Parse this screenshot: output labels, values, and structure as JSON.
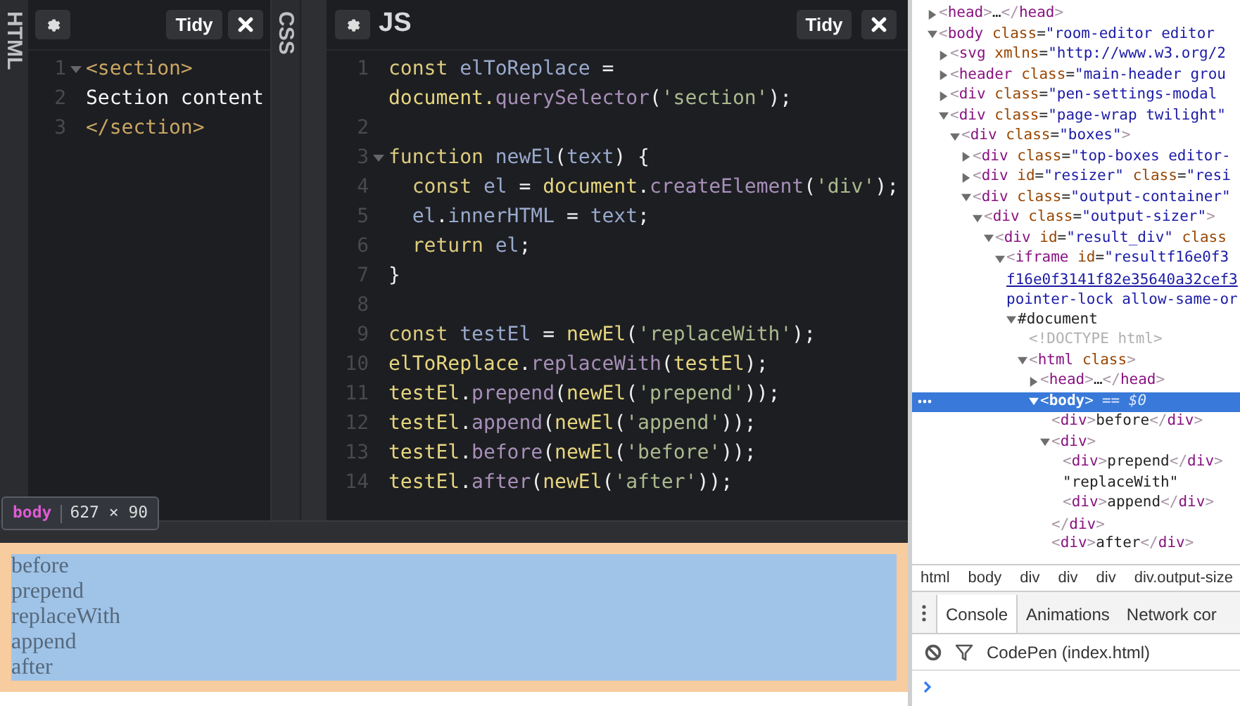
{
  "editors": {
    "html_panel": {
      "label": "HTML",
      "button": "Tidy",
      "lines": [
        {
          "number": "1",
          "foldable": true,
          "tokens": [
            {
              "text": "<section>",
              "kind": "tag"
            }
          ]
        },
        {
          "number": "2",
          "foldable": false,
          "tokens": [
            {
              "text": "Section content",
              "kind": "text"
            }
          ]
        },
        {
          "number": "3",
          "foldable": false,
          "tokens": [
            {
              "text": "</section>",
              "kind": "tag"
            }
          ]
        }
      ]
    },
    "css_panel": {
      "label": "CSS"
    },
    "js_panel": {
      "title": "JS",
      "button": "Tidy",
      "lines": [
        {
          "number": "1",
          "foldable": false,
          "tokens": [
            {
              "text": "const",
              "kind": "keyword"
            },
            {
              "text": " elToReplace",
              "kind": "variable"
            },
            {
              "text": " =",
              "kind": "punct"
            }
          ],
          "wrapped_tokens": [
            {
              "text": "document.",
              "kind": "name"
            },
            {
              "text": "querySelector",
              "kind": "method"
            },
            {
              "text": "(",
              "kind": "punct"
            },
            {
              "text": "'section'",
              "kind": "string"
            },
            {
              "text": ");",
              "kind": "punct"
            }
          ]
        },
        {
          "number": "2",
          "foldable": false
        },
        {
          "number": "3",
          "foldable": true,
          "tokens": [
            {
              "text": "function",
              "kind": "keyword"
            },
            {
              "text": " newEl",
              "kind": "variable"
            },
            {
              "text": "(",
              "kind": "punct"
            },
            {
              "text": "text",
              "kind": "variable"
            },
            {
              "text": ") {",
              "kind": "punct"
            }
          ]
        },
        {
          "number": "4",
          "foldable": false,
          "tokens": [
            {
              "text": "  const",
              "kind": "keyword"
            },
            {
              "text": " el",
              "kind": "variable"
            },
            {
              "text": " = ",
              "kind": "punct"
            },
            {
              "text": "document",
              "kind": "name"
            },
            {
              "text": ".",
              "kind": "punct"
            },
            {
              "text": "createElement",
              "kind": "method"
            },
            {
              "text": "(",
              "kind": "punct"
            },
            {
              "text": "'div'",
              "kind": "string"
            },
            {
              "text": ");",
              "kind": "punct"
            }
          ]
        },
        {
          "number": "5",
          "foldable": false,
          "tokens": [
            {
              "text": "  el",
              "kind": "variable"
            },
            {
              "text": ".",
              "kind": "punct"
            },
            {
              "text": "innerHTML",
              "kind": "variable"
            },
            {
              "text": " = ",
              "kind": "punct"
            },
            {
              "text": "text",
              "kind": "variable"
            },
            {
              "text": ";",
              "kind": "punct"
            }
          ]
        },
        {
          "number": "6",
          "foldable": false,
          "tokens": [
            {
              "text": "  return",
              "kind": "keyword"
            },
            {
              "text": " el",
              "kind": "variable"
            },
            {
              "text": ";",
              "kind": "punct"
            }
          ]
        },
        {
          "number": "7",
          "foldable": false,
          "tokens": [
            {
              "text": "}",
              "kind": "punct"
            }
          ]
        },
        {
          "number": "8",
          "foldable": false
        },
        {
          "number": "9",
          "foldable": false,
          "tokens": [
            {
              "text": "const",
              "kind": "keyword"
            },
            {
              "text": " testEl",
              "kind": "variable"
            },
            {
              "text": " = ",
              "kind": "punct"
            },
            {
              "text": "newEl",
              "kind": "name"
            },
            {
              "text": "(",
              "kind": "punct"
            },
            {
              "text": "'replaceWith'",
              "kind": "string"
            },
            {
              "text": ");",
              "kind": "punct"
            }
          ]
        },
        {
          "number": "10",
          "foldable": false,
          "tokens": [
            {
              "text": "elToReplace",
              "kind": "name"
            },
            {
              "text": ".",
              "kind": "punct"
            },
            {
              "text": "replaceWith",
              "kind": "method"
            },
            {
              "text": "(",
              "kind": "punct"
            },
            {
              "text": "testEl",
              "kind": "name"
            },
            {
              "text": ");",
              "kind": "punct"
            }
          ]
        },
        {
          "number": "11",
          "foldable": false,
          "tokens": [
            {
              "text": "testEl",
              "kind": "name"
            },
            {
              "text": ".",
              "kind": "punct"
            },
            {
              "text": "prepend",
              "kind": "method"
            },
            {
              "text": "(",
              "kind": "punct"
            },
            {
              "text": "newEl",
              "kind": "name"
            },
            {
              "text": "(",
              "kind": "punct"
            },
            {
              "text": "'prepend'",
              "kind": "string"
            },
            {
              "text": "));",
              "kind": "punct"
            }
          ]
        },
        {
          "number": "12",
          "foldable": false,
          "tokens": [
            {
              "text": "testEl",
              "kind": "name"
            },
            {
              "text": ".",
              "kind": "punct"
            },
            {
              "text": "append",
              "kind": "method"
            },
            {
              "text": "(",
              "kind": "punct"
            },
            {
              "text": "newEl",
              "kind": "name"
            },
            {
              "text": "(",
              "kind": "punct"
            },
            {
              "text": "'append'",
              "kind": "string"
            },
            {
              "text": "));",
              "kind": "punct"
            }
          ]
        },
        {
          "number": "13",
          "foldable": false,
          "tokens": [
            {
              "text": "testEl",
              "kind": "name"
            },
            {
              "text": ".",
              "kind": "punct"
            },
            {
              "text": "before",
              "kind": "method"
            },
            {
              "text": "(",
              "kind": "punct"
            },
            {
              "text": "newEl",
              "kind": "name"
            },
            {
              "text": "(",
              "kind": "punct"
            },
            {
              "text": "'before'",
              "kind": "string"
            },
            {
              "text": "));",
              "kind": "punct"
            }
          ]
        },
        {
          "number": "14",
          "foldable": false,
          "tokens": [
            {
              "text": "testEl",
              "kind": "name"
            },
            {
              "text": ".",
              "kind": "punct"
            },
            {
              "text": "after",
              "kind": "method"
            },
            {
              "text": "(",
              "kind": "punct"
            },
            {
              "text": "newEl",
              "kind": "name"
            },
            {
              "text": "(",
              "kind": "punct"
            },
            {
              "text": "'after'",
              "kind": "string"
            },
            {
              "text": "));",
              "kind": "punct"
            }
          ]
        }
      ]
    }
  },
  "inspector_tooltip": {
    "tag": "body",
    "size": "627 × 90"
  },
  "output": {
    "lines": [
      "before",
      "prepend",
      "replaceWith",
      "append",
      "after"
    ]
  },
  "devtools": {
    "elements": [
      {
        "text": "<head>…</head>",
        "expanded": false,
        "selected": false
      },
      {
        "text": "<body class=\"room-editor editor",
        "expanded": true,
        "selected": false,
        "children": [
          {
            "text": "<svg xmlns=\"http://www.w3.org/2",
            "expanded": false,
            "selected": false
          },
          {
            "text": "<header class=\"main-header grou",
            "expanded": false,
            "selected": false
          },
          {
            "text": "<div class=\"pen-settings-modal",
            "expanded": false,
            "selected": false
          },
          {
            "text": "<div class=\"page-wrap twilight\"",
            "expanded": true,
            "selected": false,
            "children": [
              {
                "text": "<div class=\"boxes\">",
                "expanded": true,
                "selected": false,
                "children": [
                  {
                    "text": "<div class=\"top-boxes editor-",
                    "expanded": false,
                    "selected": false
                  },
                  {
                    "text": "<div id=\"resizer\" class=\"resi",
                    "expanded": false,
                    "selected": false
                  },
                  {
                    "text": "<div class=\"output-container\"",
                    "expanded": true,
                    "selected": false,
                    "children": [
                      {
                        "text": "<div class=\"output-sizer\">",
                        "expanded": true,
                        "selected": false,
                        "children": [
                          {
                            "text": "<div id=\"result_div\" class",
                            "expanded": true,
                            "selected": false,
                            "children": [
                              {
                                "text": "<iframe id=\"resultf16e0f3",
                                "expanded": true,
                                "selected": false,
                                "extra_lines": [
                                  {
                                    "text": "f16e0f3141f82e35640a32cef3",
                                    "kind": "link"
                                  },
                                  {
                                    "text": "pointer-lock allow-same-or",
                                    "kind": "attribute"
                                  }
                                ],
                                "children": [
                                  {
                                    "text": "#document",
                                    "expanded": true,
                                    "selected": false,
                                    "children": [
                                      {
                                        "text": "<!DOCTYPE html>",
                                        "selected": false
                                      },
                                      {
                                        "text": "<html class>",
                                        "expanded": true,
                                        "selected": false,
                                        "children": [
                                          {
                                            "text": "<head>…</head>",
                                            "expanded": false,
                                            "selected": false
                                          },
                                          {
                                            "text": "<body>",
                                            "expanded": true,
                                            "selected": true,
                                            "marker": "== $0",
                                            "children": [
                                              {
                                                "text": "<div>before</div>",
                                                "selected": false
                                              },
                                              {
                                                "text": "<div>",
                                                "expanded": true,
                                                "selected": false,
                                                "closing": "</div>",
                                                "children": [
                                                  {
                                                    "text": "<div>prepend</div>",
                                                    "selected": false
                                                  },
                                                  {
                                                    "text": "\"replaceWith\"",
                                                    "selected": false
                                                  },
                                                  {
                                                    "text": "<div>append</div>",
                                                    "selected": false
                                                  }
                                                ]
                                              },
                                              {
                                                "text": "<div>after</div>",
                                                "selected": false
                                              }
                                            ]
                                          }
                                        ]
                                      }
                                    ]
                                  }
                                ]
                              }
                            ]
                          }
                        ]
                      }
                    ]
                  }
                ]
              }
            ]
          }
        ]
      }
    ],
    "breadcrumbs": [
      "html",
      "body",
      "div",
      "div",
      "div",
      "div.output-size"
    ],
    "drawer_tabs": [
      {
        "label": "Console",
        "selected": true
      },
      {
        "label": "Animations",
        "selected": false
      },
      {
        "label": "Network cor",
        "selected": false
      }
    ],
    "console": {
      "context": "CodePen (index.html)"
    }
  }
}
